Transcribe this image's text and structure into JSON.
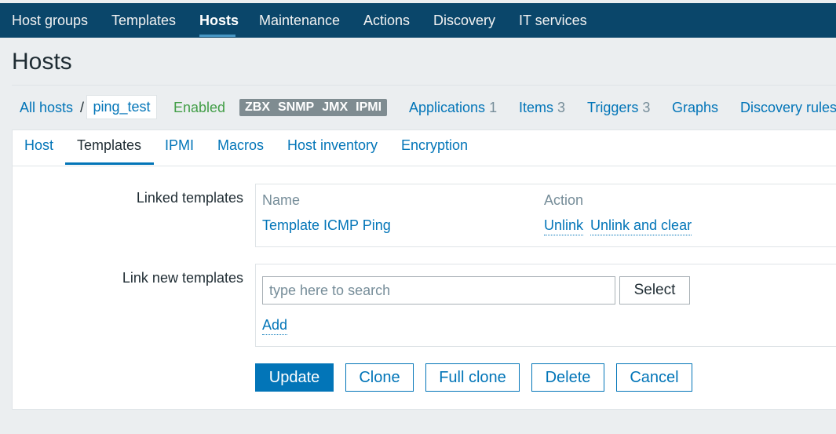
{
  "topnav": {
    "items": [
      {
        "label": "Host groups"
      },
      {
        "label": "Templates"
      },
      {
        "label": "Hosts"
      },
      {
        "label": "Maintenance"
      },
      {
        "label": "Actions"
      },
      {
        "label": "Discovery"
      },
      {
        "label": "IT services"
      }
    ],
    "active": "Hosts"
  },
  "page": {
    "title": "Hosts"
  },
  "breadcrumb": {
    "all_hosts": "All hosts",
    "separator": "/",
    "current": "ping_test",
    "status": "Enabled",
    "interfaces": [
      "ZBX",
      "SNMP",
      "JMX",
      "IPMI"
    ],
    "links": [
      {
        "label": "Applications",
        "count": "1"
      },
      {
        "label": "Items",
        "count": "3"
      },
      {
        "label": "Triggers",
        "count": "3"
      },
      {
        "label": "Graphs",
        "count": ""
      },
      {
        "label": "Discovery rules",
        "count": ""
      }
    ]
  },
  "tabs": [
    {
      "label": "Host"
    },
    {
      "label": "Templates"
    },
    {
      "label": "IPMI"
    },
    {
      "label": "Macros"
    },
    {
      "label": "Host inventory"
    },
    {
      "label": "Encryption"
    }
  ],
  "active_tab": "Templates",
  "linked_templates": {
    "label": "Linked templates",
    "headers": {
      "name": "Name",
      "action": "Action"
    },
    "rows": [
      {
        "name": "Template ICMP Ping",
        "unlink": "Unlink",
        "unlink_clear": "Unlink and clear"
      }
    ]
  },
  "link_new": {
    "label": "Link new templates",
    "placeholder": "type here to search",
    "value": "",
    "select_label": "Select",
    "add_label": "Add"
  },
  "buttons": {
    "update": "Update",
    "clone": "Clone",
    "full_clone": "Full clone",
    "delete": "Delete",
    "cancel": "Cancel"
  },
  "colors": {
    "nav_bg": "#0a466a",
    "link": "#0275b8",
    "enabled": "#429e47",
    "page_bg": "#ebeef0"
  }
}
